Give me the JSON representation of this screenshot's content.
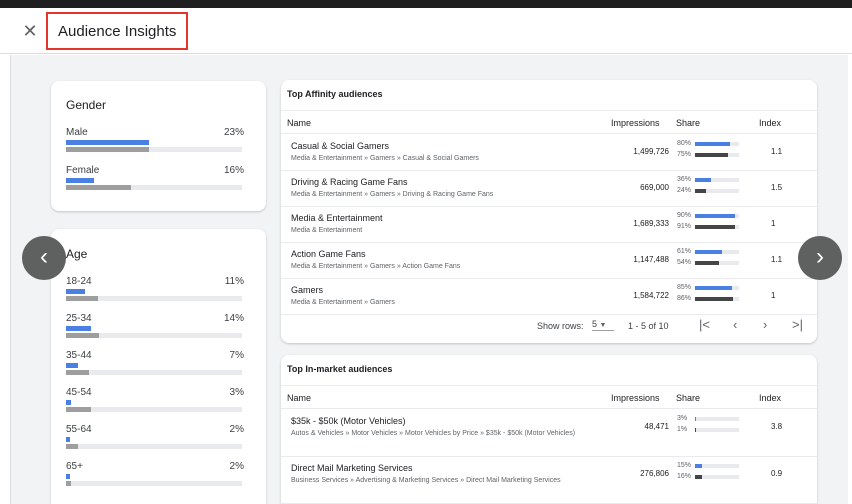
{
  "header": {
    "title": "Audience Insights",
    "close_icon": "close-icon"
  },
  "gender": {
    "title": "Gender",
    "items": [
      {
        "label": "Male",
        "pct": "23%",
        "blue": 0.47,
        "gray": 0.47
      },
      {
        "label": "Female",
        "pct": "16%",
        "blue": 0.16,
        "gray": 0.37
      }
    ]
  },
  "age": {
    "title": "Age",
    "items": [
      {
        "label": "18-24",
        "pct": "11%",
        "blue": 0.11,
        "gray": 0.18
      },
      {
        "label": "25-34",
        "pct": "14%",
        "blue": 0.14,
        "gray": 0.19
      },
      {
        "label": "35-44",
        "pct": "7%",
        "blue": 0.07,
        "gray": 0.13
      },
      {
        "label": "45-54",
        "pct": "3%",
        "blue": 0.03,
        "gray": 0.14
      },
      {
        "label": "55-64",
        "pct": "2%",
        "blue": 0.02,
        "gray": 0.07
      },
      {
        "label": "65+",
        "pct": "2%",
        "blue": 0.02,
        "gray": 0.03
      }
    ]
  },
  "affinity": {
    "title": "Top Affinity audiences",
    "columns": {
      "name": "Name",
      "impressions": "Impressions",
      "share": "Share",
      "index": "Index"
    },
    "rows": [
      {
        "name": "Casual & Social Gamers",
        "path": "Media & Entertainment » Gamers » Casual & Social Gamers",
        "impressions": "1,499,726",
        "share_a": "80%",
        "share_b": "75%",
        "a": 0.8,
        "b": 0.75,
        "index": "1.1"
      },
      {
        "name": "Driving & Racing Game Fans",
        "path": "Media & Entertainment » Gamers » Driving & Racing Game Fans",
        "impressions": "669,000",
        "share_a": "36%",
        "share_b": "24%",
        "a": 0.36,
        "b": 0.24,
        "index": "1.5"
      },
      {
        "name": "Media & Entertainment",
        "path": "Media & Entertainment",
        "impressions": "1,689,333",
        "share_a": "90%",
        "share_b": "91%",
        "a": 0.9,
        "b": 0.91,
        "index": "1"
      },
      {
        "name": "Action Game Fans",
        "path": "Media & Entertainment » Gamers » Action Game Fans",
        "impressions": "1,147,488",
        "share_a": "61%",
        "share_b": "54%",
        "a": 0.61,
        "b": 0.54,
        "index": "1.1"
      },
      {
        "name": "Gamers",
        "path": "Media & Entertainment » Gamers",
        "impressions": "1,584,722",
        "share_a": "85%",
        "share_b": "86%",
        "a": 0.85,
        "b": 0.86,
        "index": "1"
      }
    ],
    "pager": {
      "show_rows_label": "Show rows:",
      "rows_value": "5",
      "range": "1 - 5 of 10"
    }
  },
  "inmarket": {
    "title": "Top In-market audiences",
    "columns": {
      "name": "Name",
      "impressions": "Impressions",
      "share": "Share",
      "index": "Index"
    },
    "rows": [
      {
        "name": "$35k - $50k (Motor Vehicles)",
        "path": "Autos & Vehicles » Motor Vehicles » Motor Vehicles by Price » $35k - $50k (Motor Vehicles)",
        "impressions": "48,471",
        "share_a": "3%",
        "share_b": "1%",
        "a": 0.03,
        "b": 0.01,
        "index": "3.8"
      },
      {
        "name": "Direct Mail Marketing Services",
        "path": "Business Services » Advertising & Marketing Services » Direct Mail Marketing Services",
        "impressions": "276,806",
        "share_a": "15%",
        "share_b": "16%",
        "a": 0.15,
        "b": 0.16,
        "index": "0.9"
      }
    ]
  },
  "colors": {
    "accent_blue": "#4a7fe3",
    "highlight_red": "#e2362d",
    "bar_dark": "#454545",
    "bar_gray": "#9e9e9e"
  }
}
